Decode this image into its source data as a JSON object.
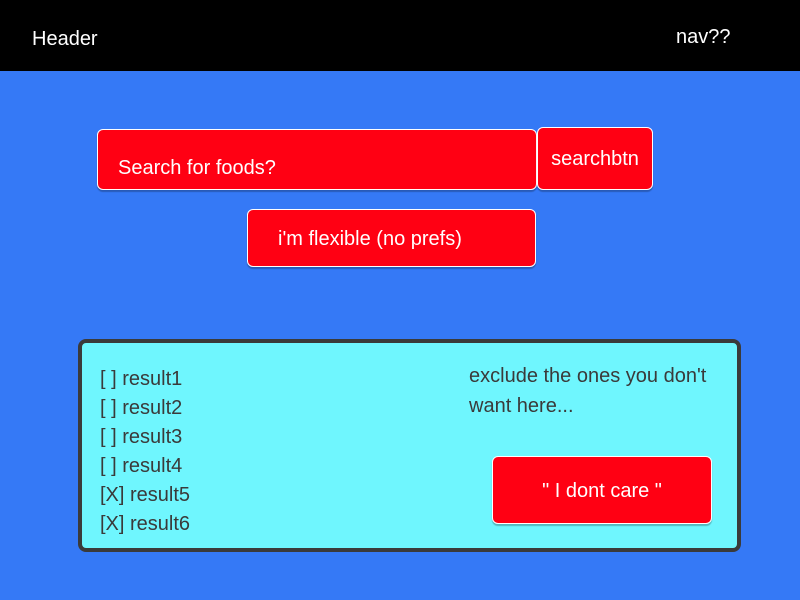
{
  "header": {
    "title": "Header",
    "nav": "nav??"
  },
  "search": {
    "placeholder": "Search for foods?",
    "button_label": "searchbtn"
  },
  "flexible_button_label": "i'm flexible (no prefs)",
  "results": {
    "items": [
      {
        "label": "[ ] result1"
      },
      {
        "label": "[ ] result2"
      },
      {
        "label": "[ ] result3"
      },
      {
        "label": "[ ] result4"
      },
      {
        "label": "[X] result5"
      },
      {
        "label": "[X] result6"
      }
    ],
    "hint": "exclude the ones you don't want here...",
    "dont_care_label": "\" I dont care \""
  },
  "colors": {
    "background": "#3579F6",
    "header": "#000000",
    "accent_red": "#FF0013",
    "panel": "#6FF6FE",
    "panel_border": "#3A3A3A"
  }
}
